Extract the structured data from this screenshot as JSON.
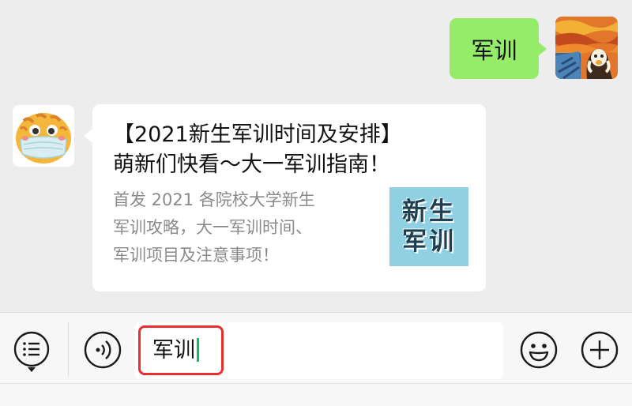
{
  "chat": {
    "outgoing": {
      "text": "军训"
    },
    "incoming": {
      "title_line1": "【2021新生军训时间及安排】",
      "title_line2": "萌新们快看～大一军训指南！",
      "desc_line1": "首发 2021 各院校大学新生",
      "desc_line2": "军训攻略，大一军训时间、",
      "desc_line3": "军训项目及注意事项！",
      "thumb_line1": "新生",
      "thumb_line2": "军训"
    }
  },
  "input_bar": {
    "text": "军训",
    "icons": {
      "menu": "list-menu-icon",
      "voice": "voice-icon",
      "emoji": "emoji-icon",
      "plus": "plus-icon"
    }
  },
  "colors": {
    "chat_background": "#ededed",
    "outgoing_bubble": "#95ec69",
    "highlight_border": "#e8312f",
    "cursor": "#07c160"
  }
}
